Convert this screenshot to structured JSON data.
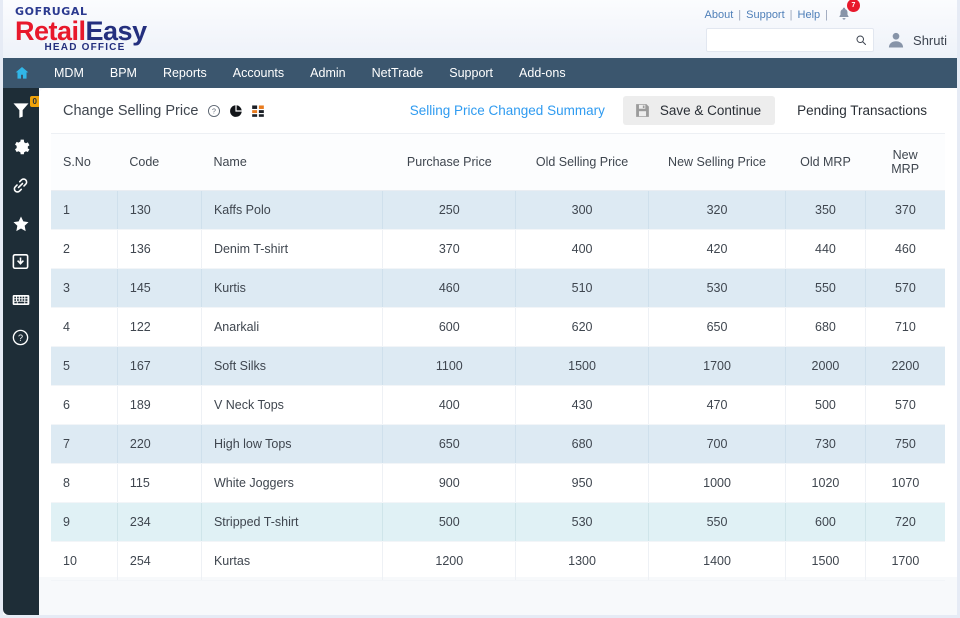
{
  "brand": {
    "top": "GOFRUGAL",
    "retail": "Retail",
    "easy": "Easy",
    "sub": "HEAD OFFICE"
  },
  "topbar": {
    "links": [
      "About",
      "Support",
      "Help"
    ],
    "notification_count": "7",
    "search_placeholder": "",
    "search_value": "",
    "user": "Shruti",
    "accent": "#e8192c"
  },
  "nav": {
    "home_icon": "home-icon",
    "items": [
      "MDM",
      "BPM",
      "Reports",
      "Accounts",
      "Admin",
      "NetTrade",
      "Support",
      "Add-ons"
    ],
    "bg": "#3b566e"
  },
  "rail": {
    "bg": "#1e2d37",
    "items": [
      {
        "icon": "filter-icon",
        "badge": "0"
      },
      {
        "icon": "gear-icon",
        "badge": ""
      },
      {
        "icon": "link-icon",
        "badge": ""
      },
      {
        "icon": "star-icon",
        "badge": ""
      },
      {
        "icon": "import-export-icon",
        "badge": ""
      },
      {
        "icon": "keyboard-icon",
        "badge": ""
      },
      {
        "icon": "help-circle-icon",
        "badge": ""
      }
    ],
    "badge_color": "#f0a30a"
  },
  "toolbar": {
    "title": "Change Selling Price",
    "help_icon": "question-circle-icon",
    "chart_icon": "pie-chart-icon",
    "grid_icon": "grid-layout-icon",
    "summary_link": "Selling Price Changed Summary",
    "summary_link_color": "#2f9bf0",
    "save_icon": "save-floppy-icon",
    "save_label": "Save & Continue",
    "pending_label": "Pending Transactions"
  },
  "table": {
    "columns": [
      "S.No",
      "Code",
      "Name",
      "Purchase Price",
      "Old Selling Price",
      "New Selling Price",
      "Old MRP",
      "New MRP"
    ],
    "rows": [
      {
        "sno": "1",
        "code": "130",
        "name": "Kaffs Polo",
        "purchase": "250",
        "old_sp": "300",
        "new_sp": "320",
        "old_mrp": "350",
        "new_mrp": "370"
      },
      {
        "sno": "2",
        "code": "136",
        "name": "Denim T-shirt",
        "purchase": "370",
        "old_sp": "400",
        "new_sp": "420",
        "old_mrp": "440",
        "new_mrp": "460"
      },
      {
        "sno": "3",
        "code": "145",
        "name": "Kurtis",
        "purchase": "460",
        "old_sp": "510",
        "new_sp": "530",
        "old_mrp": "550",
        "new_mrp": "570"
      },
      {
        "sno": "4",
        "code": "122",
        "name": "Anarkali",
        "purchase": "600",
        "old_sp": "620",
        "new_sp": "650",
        "old_mrp": "680",
        "new_mrp": "710"
      },
      {
        "sno": "5",
        "code": "167",
        "name": "Soft Silks",
        "purchase": "1100",
        "old_sp": "1500",
        "new_sp": "1700",
        "old_mrp": "2000",
        "new_mrp": "2200"
      },
      {
        "sno": "6",
        "code": "189",
        "name": "V Neck Tops",
        "purchase": "400",
        "old_sp": "430",
        "new_sp": "470",
        "old_mrp": "500",
        "new_mrp": "570"
      },
      {
        "sno": "7",
        "code": "220",
        "name": "High low Tops",
        "purchase": "650",
        "old_sp": "680",
        "new_sp": "700",
        "old_mrp": "730",
        "new_mrp": "750"
      },
      {
        "sno": "8",
        "code": "115",
        "name": "White Joggers",
        "purchase": "900",
        "old_sp": "950",
        "new_sp": "1000",
        "old_mrp": "1020",
        "new_mrp": "1070"
      },
      {
        "sno": "9",
        "code": "234",
        "name": "Stripped T-shirt",
        "purchase": "500",
        "old_sp": "530",
        "new_sp": "550",
        "old_mrp": "600",
        "new_mrp": "720"
      },
      {
        "sno": "10",
        "code": "254",
        "name": "Kurtas",
        "purchase": "1200",
        "old_sp": "1300",
        "new_sp": "1400",
        "old_mrp": "1500",
        "new_mrp": "1700"
      }
    ]
  }
}
